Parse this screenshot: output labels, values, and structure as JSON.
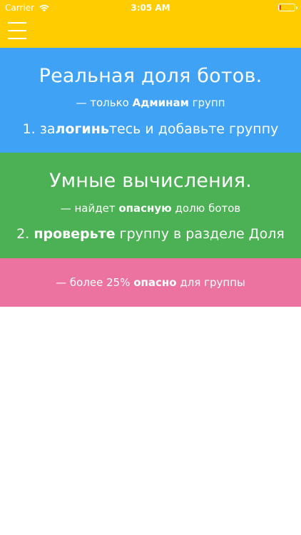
{
  "status_bar": {
    "carrier": "Carrier",
    "time": "3:05 AM",
    "battery_level": 0.1
  },
  "toolbar": {
    "menu_icon": "hamburger-menu-icon"
  },
  "sections": [
    {
      "color": "#40A2F5",
      "title": "Реальная доля ботов.",
      "subtitle": {
        "prefix": "— только ",
        "bold": "Админам",
        "suffix": " групп"
      },
      "step": {
        "prefix": "1. за",
        "bold": "логинь",
        "suffix": "тесь и добавьте группу"
      }
    },
    {
      "color": "#4CB154",
      "title": "Умные вычисления.",
      "subtitle": {
        "prefix": "— найдет ",
        "bold": "опасную",
        "suffix": " долю ботов"
      },
      "step": {
        "prefix": "2. ",
        "bold": "проверьте",
        "suffix": " группу в разделе Доля"
      }
    },
    {
      "color": "#EC72A0",
      "subtitle": {
        "prefix": "— более 25% ",
        "bold": "опасно",
        "suffix": " для группы"
      }
    }
  ],
  "colors": {
    "topbar": "#FFCC00",
    "text": "#FFFFFF",
    "battery": "#E53935"
  }
}
